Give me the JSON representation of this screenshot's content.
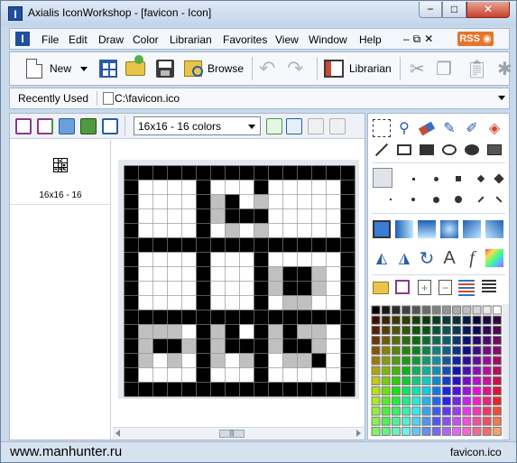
{
  "window": {
    "title": "Axialis IconWorkshop - [favicon - Icon]",
    "minimize_glyph": "−",
    "maximize_glyph": "□",
    "close_glyph": "✕"
  },
  "menubar": {
    "items": [
      "File",
      "Edit",
      "Draw",
      "Color",
      "Librarian",
      "Favorites",
      "View",
      "Window",
      "Help"
    ],
    "mdi_controls": "–⧉✕",
    "rss_label": "RSS",
    "app_icon_glyph": "I"
  },
  "toolbar": {
    "new_label": "New",
    "browse_label": "Browse",
    "librarian_label": "Librarian"
  },
  "addressbar": {
    "recent_label": "Recently Used",
    "path_value": "C:\\favicon.ico"
  },
  "document": {
    "format_selected": "16x16 - 16 colors",
    "thumb_label": "16x16 - 16"
  },
  "icon_pixels": [
    "2222222222222222",
    "2000020002000002",
    "2000021201000002",
    "2000021222000002",
    "2000020101000002",
    "2222222222222222",
    "2000020002000002",
    "2000020002122102",
    "2000020002122102",
    "2000020002011002",
    "2222222222222222",
    "2111021202121102",
    "2122121222122102",
    "2101021012011202",
    "2000020002000002",
    "2222222222222222"
  ],
  "pixel_colors": {
    "0": "#ffffff",
    "1": "#c0c0c0",
    "2": "#000000"
  },
  "statusbar": {
    "left_text": "www.manhunter.ru",
    "right_text": "favicon.ico"
  }
}
